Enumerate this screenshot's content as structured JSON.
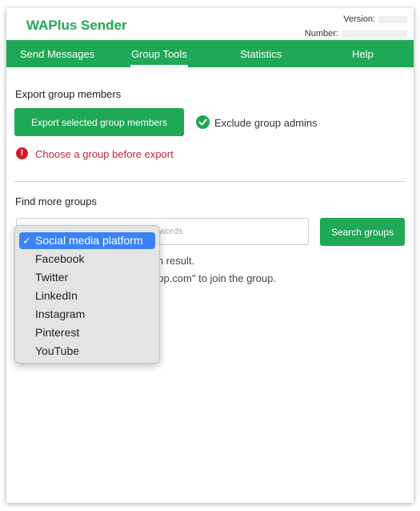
{
  "header": {
    "title": "WAPlus Sender",
    "version_label": "Version:",
    "number_label": "Number:"
  },
  "nav": {
    "items": [
      {
        "label": "Send Messages"
      },
      {
        "label": "Group Tools"
      },
      {
        "label": "Statistics"
      },
      {
        "label": "Help"
      }
    ],
    "active": "Group Tools"
  },
  "export_section": {
    "title": "Export group members",
    "export_button": "Export selected group members",
    "exclude_admins_label": "Exclude group admins",
    "exclude_admins_checked": true,
    "error_message": "Choose a group before export"
  },
  "find_section": {
    "title": "Find more groups",
    "search_placeholder": "words",
    "search_button": "Search groups",
    "hint_line1": "rch result.",
    "hint_line2": "app.com\" to join the group."
  },
  "platform_dropdown": {
    "selected": "Social media platform",
    "options": [
      {
        "label": "Social media platform"
      },
      {
        "label": "Facebook"
      },
      {
        "label": "Twitter"
      },
      {
        "label": "LinkedIn"
      },
      {
        "label": "Instagram"
      },
      {
        "label": "Pinterest"
      },
      {
        "label": "YouTube"
      }
    ]
  },
  "colors": {
    "brand_green": "#1fa855",
    "error_red": "#d11a2a",
    "selection_blue": "#3b82f6"
  }
}
